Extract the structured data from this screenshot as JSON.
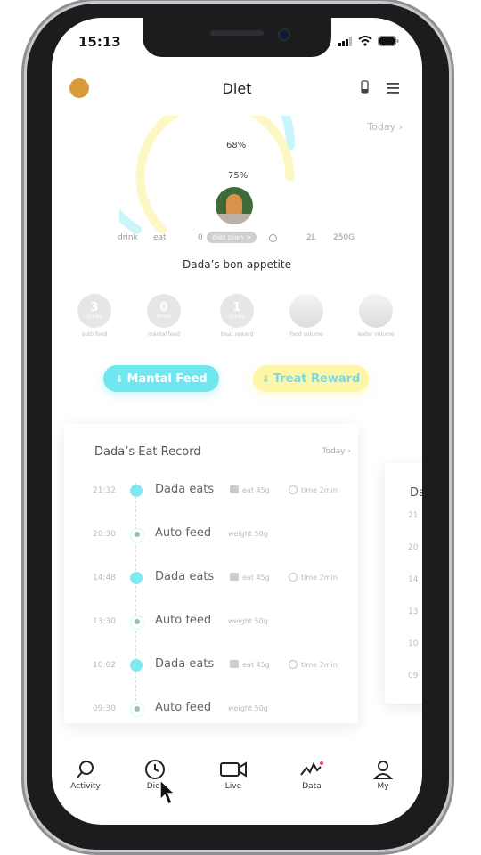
{
  "status_bar": {
    "time": "15:13"
  },
  "header": {
    "title": "Diet"
  },
  "summary": {
    "date_filter": "Today",
    "gauge": {
      "drink_percent": "68%",
      "eat_percent": "75%",
      "drink_fraction": 0.68,
      "eat_fraction": 0.75,
      "drink_label": "drink",
      "eat_label": "eat",
      "zero_label": "0",
      "diet_plan_label": "diet plan >",
      "liters_label": "2L",
      "grams_label": "250G"
    },
    "pet_caption": "Dada’s bon appetite",
    "stats": [
      {
        "value": "3",
        "unit": "times",
        "label": "auto feed"
      },
      {
        "value": "0",
        "unit": "times",
        "label": "mantal feed"
      },
      {
        "value": "1",
        "unit": "times",
        "label": "treat reward"
      },
      {
        "value": "",
        "unit": "",
        "label": "food volume"
      },
      {
        "value": "",
        "unit": "",
        "label": "water volume"
      }
    ]
  },
  "actions": {
    "manual_feed": "Mantal Feed",
    "treat_reward": "Treat Reward"
  },
  "record": {
    "title": "Dada’s Eat Record",
    "date_filter": "Today",
    "entries": [
      {
        "time": "21:32",
        "title": "Dada eats",
        "info1": "eat 45g",
        "info2": "time 2min",
        "kind": "eat"
      },
      {
        "time": "20:30",
        "title": "Auto feed",
        "info1": "weight 50g",
        "info2": "",
        "kind": "auto"
      },
      {
        "time": "14:48",
        "title": "Dada eats",
        "info1": "eat 45g",
        "info2": "time 2min",
        "kind": "eat"
      },
      {
        "time": "13:30",
        "title": "Auto feed",
        "info1": "weight 50g",
        "info2": "",
        "kind": "auto"
      },
      {
        "time": "10:02",
        "title": "Dada eats",
        "info1": "eat 45g",
        "info2": "time 2min",
        "kind": "eat"
      },
      {
        "time": "09:30",
        "title": "Auto feed",
        "info1": "weight 50g",
        "info2": "",
        "kind": "auto"
      }
    ],
    "second_card": {
      "title": "Da",
      "times": [
        "21",
        "20",
        "14",
        "13",
        "10",
        "09"
      ]
    }
  },
  "tabbar": {
    "items": [
      {
        "label": "Activity",
        "icon": "search-icon"
      },
      {
        "label": "Diet",
        "icon": "clock-icon"
      },
      {
        "label": "Live",
        "icon": "video-icon"
      },
      {
        "label": "Data",
        "icon": "chart-icon"
      },
      {
        "label": "My",
        "icon": "user-icon"
      }
    ]
  },
  "colors": {
    "cyan": "#7fe9f2",
    "yellow": "#fdf6a6",
    "text": "#222222"
  }
}
